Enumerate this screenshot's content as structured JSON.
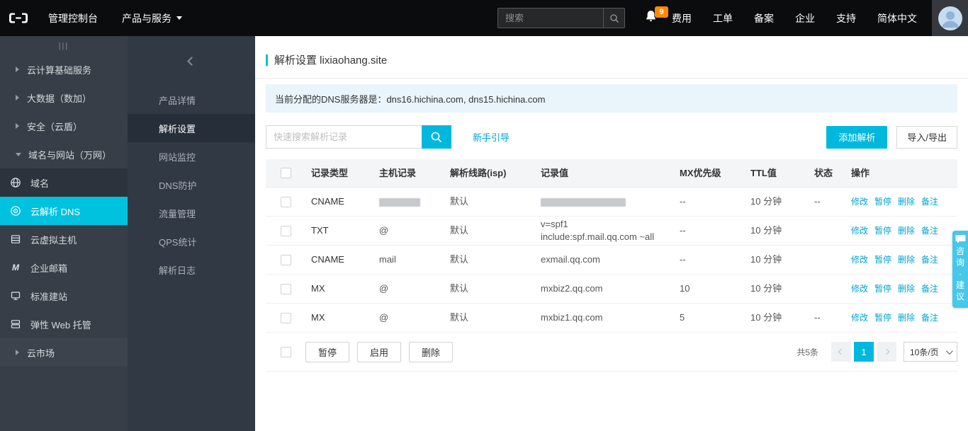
{
  "colors": {
    "accent": "#00c1de",
    "button": "#00b8dd",
    "link": "#00a4d3",
    "badge": "#ff8a00"
  },
  "topbar": {
    "console_label": "管理控制台",
    "products_label": "产品与服务",
    "search_placeholder": "搜索",
    "notification_count": "9",
    "links": [
      "费用",
      "工单",
      "备案",
      "企业",
      "支持",
      "简体中文"
    ]
  },
  "sidebar": {
    "collapse_icon": "|||",
    "items": [
      {
        "label": "云计算基础服务"
      },
      {
        "label": "大数据（数加）"
      },
      {
        "label": "安全（云盾）"
      },
      {
        "label": "域名与网站（万网）"
      },
      {
        "label": "域名"
      },
      {
        "label": "云解析 DNS"
      },
      {
        "label": "云虚拟主机"
      },
      {
        "label": "企业邮箱"
      },
      {
        "label": "标准建站"
      },
      {
        "label": "弹性 Web 托管"
      },
      {
        "label": "云市场"
      }
    ]
  },
  "icons": {
    "enterprise_mail_glyph": "M"
  },
  "submenu": {
    "items": [
      "产品详情",
      "解析设置",
      "网站监控",
      "DNS防护",
      "流量管理",
      "QPS统计",
      "解析日志"
    ]
  },
  "main": {
    "title": "解析设置 lixiaohang.site",
    "banner": "当前分配的DNS服务器是：dns16.hichina.com, dns15.hichina.com",
    "search_placeholder": "快速搜索解析记录",
    "guide_link": "新手引导",
    "add_button": "添加解析",
    "import_export_button": "导入/导出",
    "table": {
      "headers": [
        "记录类型",
        "主机记录",
        "解析线路(isp)",
        "记录值",
        "MX优先级",
        "TTL值",
        "状态",
        "操作"
      ],
      "action_labels": [
        "修改",
        "暂停",
        "删除",
        "备注"
      ],
      "rows": [
        {
          "type": "CNAME",
          "host": "",
          "line": "默认",
          "value": "",
          "mx": "--",
          "ttl": "10 分钟",
          "status": "--",
          "host_redacted": true,
          "value_redacted": true
        },
        {
          "type": "TXT",
          "host": "@",
          "line": "默认",
          "value": "v=spf1 include:spf.mail.qq.com ~all",
          "mx": "--",
          "ttl": "10 分钟",
          "status": ""
        },
        {
          "type": "CNAME",
          "host": "mail",
          "line": "默认",
          "value": "exmail.qq.com",
          "mx": "--",
          "ttl": "10 分钟",
          "status": ""
        },
        {
          "type": "MX",
          "host": "@",
          "line": "默认",
          "value": "mxbiz2.qq.com",
          "mx": "10",
          "ttl": "10 分钟",
          "status": ""
        },
        {
          "type": "MX",
          "host": "@",
          "line": "默认",
          "value": "mxbiz1.qq.com",
          "mx": "5",
          "ttl": "10 分钟",
          "status": "--"
        }
      ]
    },
    "footer": {
      "pause": "暂停",
      "enable": "启用",
      "delete": "删除",
      "total": "共5条",
      "page": "1",
      "page_size": "10条/页"
    }
  },
  "feedback_label": "咨询·建议"
}
